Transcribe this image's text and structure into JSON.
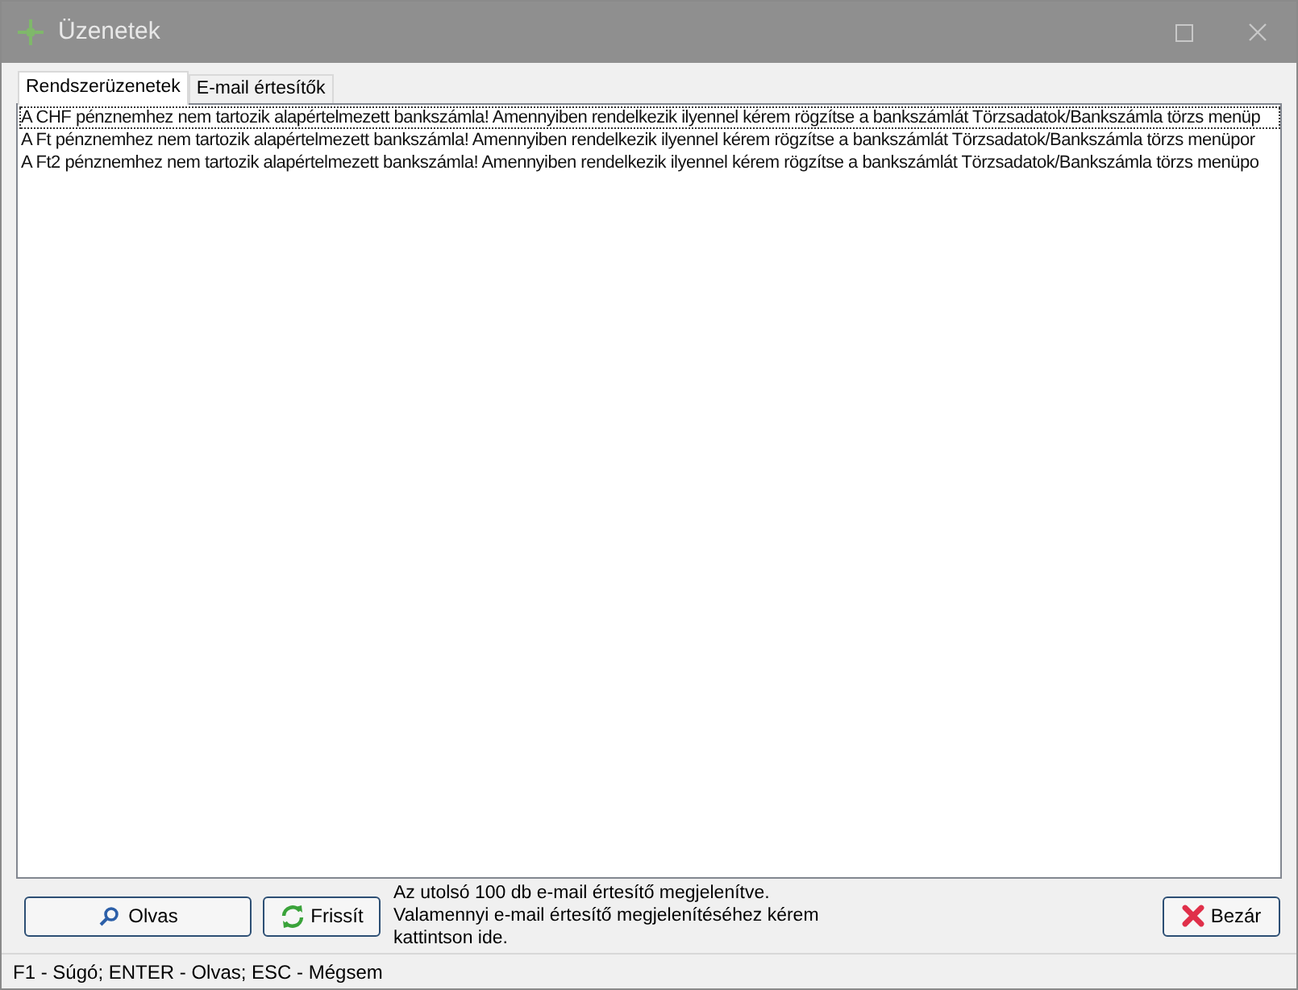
{
  "window": {
    "title": "Üzenetek"
  },
  "tabs": [
    {
      "label": "Rendszerüzenetek",
      "selected": true
    },
    {
      "label": "E-mail értesítők",
      "selected": false
    }
  ],
  "messages": [
    {
      "text": "A CHF pénznemhez nem tartozik alapértelmezett bankszámla! Amennyiben rendelkezik ilyennel kérem rögzítse a bankszámlát Törzsadatok/Bankszámla törzs menüp",
      "selected": true
    },
    {
      "text": "A Ft pénznemhez nem tartozik alapértelmezett bankszámla! Amennyiben rendelkezik ilyennel kérem rögzítse a bankszámlát Törzsadatok/Bankszámla törzs menüpor",
      "selected": false
    },
    {
      "text": "A Ft2 pénznemhez nem tartozik alapértelmezett bankszámla! Amennyiben rendelkezik ilyennel kérem rögzítse a bankszámlát Törzsadatok/Bankszámla törzs menüpo",
      "selected": false
    }
  ],
  "buttons": {
    "read": "Olvas",
    "refresh": "Frissít",
    "close": "Bezár"
  },
  "info_text": "Az utolsó 100 db e-mail értesítő megjelenítve. Valamennyi e-mail értesítő megjelenítéséhez kérem kattintson ide.",
  "status_bar": "F1 - Súgó; ENTER - Olvas; ESC - Mégsem"
}
